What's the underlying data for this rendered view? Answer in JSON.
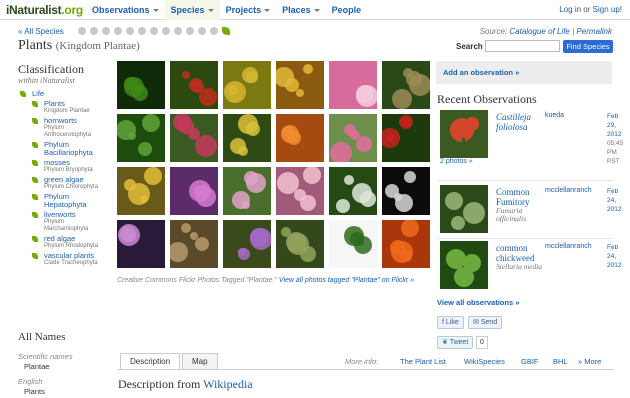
{
  "header": {
    "logo_main": "iNaturalist",
    "logo_tld": ".org",
    "nav": [
      {
        "label": "Observations",
        "caret": true
      },
      {
        "label": "Species",
        "caret": true,
        "active": true
      },
      {
        "label": "Projects",
        "caret": true
      },
      {
        "label": "Places",
        "caret": true
      },
      {
        "label": "People",
        "caret": false
      }
    ],
    "login": "Log in",
    "or": " or ",
    "signup": "Sign up!"
  },
  "subheader": {
    "all_species": "« All Species",
    "source_label": "Source:",
    "source_link": "Catalogue of Life",
    "separator": "|",
    "permalink": "Permalink"
  },
  "taxon": {
    "name": "Plants",
    "rank_label": "(Kingdom Plantae)"
  },
  "search": {
    "label": "Search",
    "placeholder": "",
    "button": "Find Species"
  },
  "classification": {
    "heading": "Classification",
    "subheading": "within iNaturalist",
    "ancestors": [
      {
        "name": "Life",
        "rank": ""
      },
      {
        "name": "Plants",
        "rank": "Kingdom Plantae"
      }
    ],
    "children": [
      {
        "name": "hornworts",
        "rank": "Phylum Anthocerotophyta"
      },
      {
        "name": "Phylum Bacillariophyta",
        "rank": ""
      },
      {
        "name": "mosses",
        "rank": "Phylum Bryophyta"
      },
      {
        "name": "green algae",
        "rank": "Phylum Chlorophyta"
      },
      {
        "name": "Phylum Hepatophyta",
        "rank": ""
      },
      {
        "name": "liverworts",
        "rank": "Phylum Marchantiophyta"
      },
      {
        "name": "red algae",
        "rank": "Phylum Rhodophyta"
      },
      {
        "name": "vascular plants",
        "rank": "Clade Tracheophyta"
      }
    ]
  },
  "all_names": {
    "heading": "All Names",
    "scientific_label": "Scientific names",
    "scientific_value": "Plantae",
    "english_label": "English",
    "english_value": "Plants"
  },
  "photo_grid": {
    "credit_text": "Creative Commons Flickr Photos Tagged \"Plantae.\"",
    "credit_link": "View all photos tagged \"Plantae\" on Flickr »",
    "photos": [
      {
        "subject": "fern frond",
        "colors": [
          "#0e2a08",
          "#3f8a18"
        ]
      },
      {
        "subject": "red seeds",
        "colors": [
          "#2c4a10",
          "#c22b1c"
        ]
      },
      {
        "subject": "moss sporophytes",
        "colors": [
          "#7a7a10",
          "#d6b632"
        ]
      },
      {
        "subject": "autumn trees",
        "colors": [
          "#8a5a10",
          "#e3b738"
        ]
      },
      {
        "subject": "pink blossoms",
        "colors": [
          "#d86b9e",
          "#f4c9dc"
        ]
      },
      {
        "subject": "succulent rosette",
        "colors": [
          "#294a16",
          "#9a8a56"
        ]
      },
      {
        "subject": "grass blades",
        "colors": [
          "#1d4d0d",
          "#5fa33a"
        ]
      },
      {
        "subject": "columbine flower",
        "colors": [
          "#3a5a22",
          "#c7395a"
        ]
      },
      {
        "subject": "yellow bells",
        "colors": [
          "#2f4a12",
          "#d9c13a"
        ]
      },
      {
        "subject": "orange poppy",
        "colors": [
          "#a54a10",
          "#f28c33"
        ]
      },
      {
        "subject": "pink powderpuff",
        "colors": [
          "#6c8f4c",
          "#e46da0"
        ]
      },
      {
        "subject": "red berries",
        "colors": [
          "#1c3a0c",
          "#c4231c"
        ]
      },
      {
        "subject": "yellow flowers",
        "colors": [
          "#6a5a1a",
          "#e2bd3a"
        ]
      },
      {
        "subject": "mimosa bloom",
        "colors": [
          "#5c2c6a",
          "#d67ad0"
        ]
      },
      {
        "subject": "pink cluster",
        "colors": [
          "#4a6e2c",
          "#e0a3c8"
        ]
      },
      {
        "subject": "pink orchids",
        "colors": [
          "#a05a7a",
          "#f2c2d0"
        ]
      },
      {
        "subject": "white flowers",
        "colors": [
          "#264a14",
          "#dfe8d8"
        ]
      },
      {
        "subject": "spider lily",
        "colors": [
          "#0c0c0c",
          "#d8d8d8"
        ]
      },
      {
        "subject": "purple orchid",
        "colors": [
          "#2a1a3a",
          "#c98ad4"
        ]
      },
      {
        "subject": "dry grass",
        "colors": [
          "#5a4a2a",
          "#b49a6a"
        ]
      },
      {
        "subject": "purple orchids",
        "colors": [
          "#3a4a1a",
          "#a56ac8"
        ]
      },
      {
        "subject": "reeds",
        "colors": [
          "#34481c",
          "#93a35c"
        ]
      },
      {
        "subject": "maple leaf",
        "colors": [
          "#f6f6f6",
          "#2f6a1c"
        ]
      },
      {
        "subject": "red maple",
        "colors": [
          "#a8380c",
          "#f06a1c"
        ]
      }
    ]
  },
  "tabs": {
    "items": [
      "Description",
      "Map"
    ],
    "more_info_label": "More info:",
    "links": [
      "The Plant List",
      "WikiSpecies",
      "GBIF",
      "BHL",
      "» More"
    ]
  },
  "description": {
    "heading_prefix": "Description from ",
    "heading_link": "Wikipedia"
  },
  "sidebar": {
    "add_observation": "Add an observation »",
    "recent_heading": "Recent Observations",
    "observations": [
      {
        "common": "Castilleja foliolosa",
        "scientific": "",
        "italic": true,
        "user": "kueda",
        "date_lines": [
          "Feb",
          "29,",
          "2012"
        ],
        "time_lines": [
          "05:45",
          "PM",
          "PST"
        ],
        "photos_link": "2 photos »",
        "colors": [
          "#3a5a22",
          "#d2452a"
        ]
      },
      {
        "common": "Common Fumitory",
        "scientific": "Fumaria officinalis",
        "italic": false,
        "user": "mcclellanranch",
        "date_lines": [
          "Feb",
          "24,",
          "2012"
        ],
        "time_lines": [],
        "photos_link": "",
        "colors": [
          "#2a4a1a",
          "#8aa86a"
        ]
      },
      {
        "common": "common chickweed",
        "scientific": "Stellaria media",
        "italic": false,
        "user": "mcclellanranch",
        "date_lines": [
          "Feb",
          "24,",
          "2012"
        ],
        "time_lines": [],
        "photos_link": "",
        "colors": [
          "#1f4a12",
          "#6aa83c"
        ]
      }
    ],
    "view_all": "View all observations »",
    "like": "Like",
    "send": "Send",
    "tweet": "Tweet",
    "tweet_count": "0"
  }
}
